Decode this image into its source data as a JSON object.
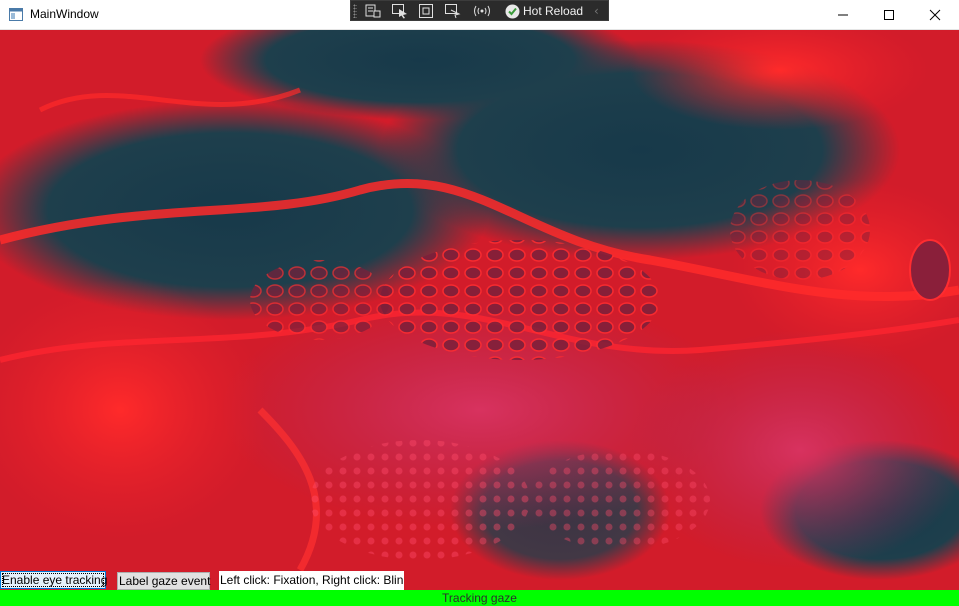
{
  "window": {
    "title": "MainWindow"
  },
  "debug_toolbar": {
    "tools": [
      "live-visual-tree-icon",
      "select-element-icon",
      "display-layout-adorners-icon",
      "track-focused-element-icon",
      "binding-failures-icon"
    ],
    "hot_reload_label": "Hot Reload",
    "collapse_glyph": "‹"
  },
  "window_controls": [
    "minimize",
    "maximize",
    "close"
  ],
  "main": {
    "background_image": "fluid-art-red-teal-background"
  },
  "controls": {
    "enable_eye_tracking_label": "Enable eye tracking",
    "label_gaze_event_label": "Label gaze event",
    "instructions_text": "Left click: Fixation, Right click: Blink"
  },
  "status": {
    "text": "Tracking gaze",
    "color": "#00ff00"
  },
  "colors": {
    "fluid_red": "#e8202a",
    "fluid_teal": "#1e3f4c",
    "fluid_magenta": "#c42a5a"
  }
}
